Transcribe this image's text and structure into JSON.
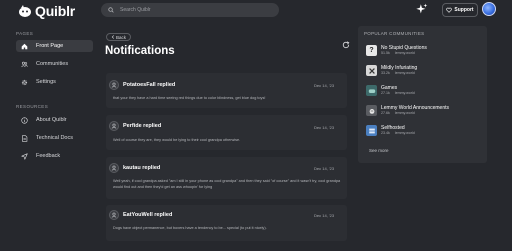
{
  "header": {
    "app_name": "Quiblr",
    "search_placeholder": "Search Quiblr",
    "support_label": "Support"
  },
  "sidebar": {
    "pages_heading": "PAGES",
    "pages": [
      {
        "label": "Front Page",
        "icon": "home-icon",
        "active": true
      },
      {
        "label": "Communities",
        "icon": "people-icon",
        "active": false
      },
      {
        "label": "Settings",
        "icon": "gear-icon",
        "active": false
      }
    ],
    "resources_heading": "RESOURCES",
    "resources": [
      {
        "label": "About Quiblr",
        "icon": "info-icon"
      },
      {
        "label": "Technical Docs",
        "icon": "document-icon"
      },
      {
        "label": "Feedback",
        "icon": "send-icon"
      }
    ]
  },
  "main": {
    "back_label": "Back",
    "title": "Notifications",
    "notifications": [
      {
        "title": "PotatoesFall replied",
        "date": "Dec 14, '23",
        "body": "that your they have a hard time seeing red things due to color blindness, get blue dog toys!"
      },
      {
        "title": "Perfide replied",
        "date": "Dec 14, '23",
        "body": "Well of course they are, they would be lying to their cool grandpa otherwise."
      },
      {
        "title": "kautau replied",
        "date": "Dec 14, '23",
        "body": "Well yeah, if cool grandpa asked \"am I still in your phone as cool grandpa\" and then they said \"of course\" and it wasn't try, cool grandpa would find out and then they'd get an ass whoopin' for lying"
      },
      {
        "title": "EatYouWell replied",
        "date": "Dec 14, '23",
        "body": "Dogs have object permanence, but boxers have a tendency to be... special (to put it nicely)."
      }
    ]
  },
  "popular": {
    "heading": "POPULAR COMMUNITIES",
    "see_more": "See more",
    "communities": [
      {
        "name": "No Stupid Questions",
        "count": "51.5k",
        "instance": "lemmy.world",
        "icon": "question-mark-icon",
        "color": "#e8e8e8"
      },
      {
        "name": "Mildly Infuriating",
        "count": "33.2k",
        "instance": "lemmy.world",
        "icon": "mildly-infuriating-icon",
        "color": "#d8d8d8"
      },
      {
        "name": "Games",
        "count": "27.1k",
        "instance": "lemmy.world",
        "icon": "games-icon",
        "color": "#3d6a6a"
      },
      {
        "name": "Lemmy World Announcements",
        "count": "27.6k",
        "instance": "lemmy.world",
        "icon": "lemmy-icon",
        "color": "#5a5c61"
      },
      {
        "name": "Selfhosted",
        "count": "23.4k",
        "instance": "lemmy.world",
        "icon": "selfhosted-icon",
        "color": "#4a7fc0"
      }
    ]
  }
}
